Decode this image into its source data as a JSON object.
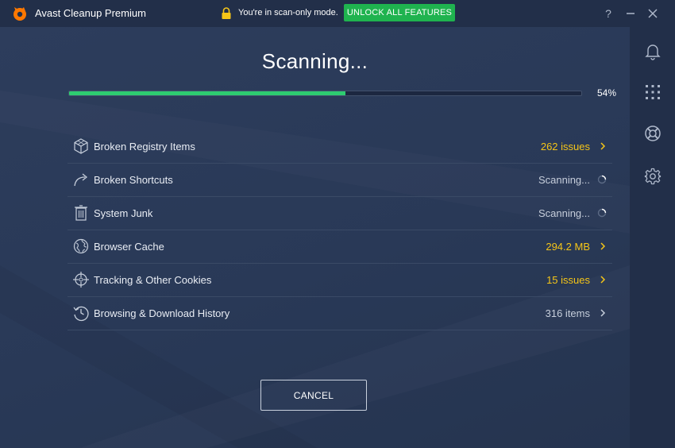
{
  "titlebar": {
    "app_title": "Avast Cleanup Premium",
    "scan_mode_text": "You're in scan-only mode.",
    "unlock_label": "UNLOCK ALL FEATURES",
    "help_label": "?",
    "logo_icon": "avast-logo-icon",
    "lock_icon": "lock-icon",
    "brand_color": "#ff7800",
    "unlock_color": "#1fb34f"
  },
  "scan": {
    "title": "Scanning...",
    "progress_percent": 54,
    "progress_label": "54%"
  },
  "items": [
    {
      "label": "Broken Registry Items",
      "status": "262 issues",
      "state": "issues",
      "icon": "registry-cube-icon"
    },
    {
      "label": "Broken Shortcuts",
      "status": "Scanning...",
      "state": "scanning",
      "icon": "shortcut-arrow-icon"
    },
    {
      "label": "System Junk",
      "status": "Scanning...",
      "state": "scanning",
      "icon": "trash-icon"
    },
    {
      "label": "Browser Cache",
      "status": "294.2 MB",
      "state": "issues",
      "icon": "globe-icon"
    },
    {
      "label": "Tracking & Other Cookies",
      "status": "15 issues",
      "state": "issues",
      "icon": "crosshair-icon"
    },
    {
      "label": "Browsing & Download History",
      "status": "316 items",
      "state": "normal",
      "icon": "history-icon"
    }
  ],
  "cancel_label": "CANCEL",
  "sidebar": {
    "icons": [
      "bell-icon",
      "apps-grid-icon",
      "lifebuoy-icon",
      "gear-icon"
    ]
  },
  "colors": {
    "issue": "#f5c518",
    "progress": "#2ecc71",
    "background": "#2a3a57"
  }
}
